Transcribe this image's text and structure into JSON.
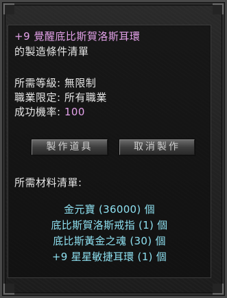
{
  "item": {
    "title": "+9 覺醒底比斯賀洛斯耳環",
    "subtitle": "的製造條件清單"
  },
  "requirements": {
    "level": {
      "label": "所需等級:",
      "value": "無限制"
    },
    "class": {
      "label": "職業限定:",
      "value": "所有職業"
    },
    "success": {
      "label": "成功機率:",
      "value": "100"
    }
  },
  "buttons": {
    "make": "製作道具",
    "cancel": "取消製作"
  },
  "materials": {
    "heading": "所需材料清單:",
    "items": [
      "金元寶 (36000) 個",
      "底比斯賀洛斯戒指 (1) 個",
      "底比斯黃金之魂 (30) 個",
      "+9 星星敏捷耳環 (1) 個"
    ]
  },
  "colors": {
    "title": "#e4a2ea",
    "text": "#e6e6e6",
    "material": "#8ee0f0",
    "panel": "#1c1c1c"
  }
}
